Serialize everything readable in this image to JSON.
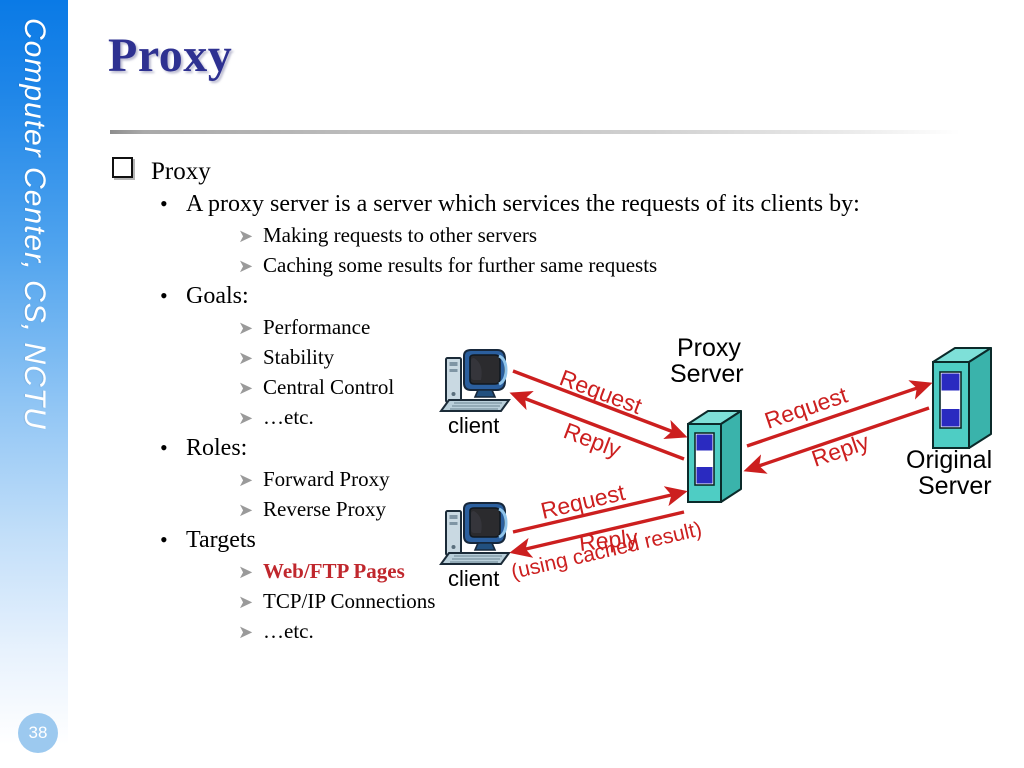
{
  "sidebar": {
    "label": "Computer Center, CS, NCTU",
    "page_number": "38",
    "gradient_top_color": "#0a7ae6",
    "badge_color": "#9cc9ef"
  },
  "slide": {
    "title": "Proxy",
    "title_color": "#2e3191",
    "rule_color": "#a9a9a9"
  },
  "outline": {
    "heading": "Proxy",
    "bullets": [
      {
        "level": 2,
        "text": "A proxy server is a server which services the requests of its clients by:",
        "marker": "bullet-dot"
      },
      {
        "level": 3,
        "text": "Making requests to other servers",
        "marker": "arrowhead"
      },
      {
        "level": 3,
        "text": "Caching some results for further same requests",
        "marker": "arrowhead"
      },
      {
        "level": 2,
        "text": "Goals:",
        "marker": "bullet-dot"
      },
      {
        "level": 3,
        "text": "Performance",
        "marker": "arrowhead"
      },
      {
        "level": 3,
        "text": "Stability",
        "marker": "arrowhead"
      },
      {
        "level": 3,
        "text": "Central Control",
        "marker": "arrowhead"
      },
      {
        "level": 3,
        "text": "…etc.",
        "marker": "arrowhead"
      },
      {
        "level": 2,
        "text": "Roles:",
        "marker": "bullet-dot"
      },
      {
        "level": 3,
        "text": "Forward Proxy",
        "marker": "arrowhead"
      },
      {
        "level": 3,
        "text": "Reverse Proxy",
        "marker": "arrowhead"
      },
      {
        "level": 2,
        "text": "Targets",
        "marker": "bullet-dot"
      },
      {
        "level": 3,
        "text": "Web/FTP Pages",
        "marker": "arrowhead",
        "highlight": true,
        "color": "#c0272d"
      },
      {
        "level": 3,
        "text": "TCP/IP Connections",
        "marker": "arrowhead"
      },
      {
        "level": 3,
        "text": "…etc.",
        "marker": "arrowhead"
      }
    ],
    "items": {
      "b0": "A proxy server is a server which services the requests of its clients by:",
      "b1": "Making requests to other servers",
      "b2": "Caching some results for further same requests",
      "b3": "Goals:",
      "b4": "Performance",
      "b5": "Stability",
      "b6": "Central Control",
      "b7": "…etc.",
      "b8": "Roles:",
      "b9": "Forward Proxy",
      "b10": "Reverse Proxy",
      "b11": "Targets",
      "b12": "Web/FTP Pages",
      "b13": "TCP/IP Connections",
      "b14": "…etc."
    }
  },
  "diagram": {
    "nodes": {
      "client_top": "client",
      "client_bottom": "client",
      "proxy_line1": "Proxy",
      "proxy_line2": "Server",
      "origin_line1": "Original",
      "origin_line2": "Server"
    },
    "edges": {
      "top_request": "Request",
      "top_reply": "Reply",
      "right_request": "Request",
      "right_reply": "Reply",
      "bottom_request": "Request",
      "bottom_reply": "Reply",
      "bottom_note": "(using cached result)"
    },
    "colors": {
      "arrow": "#cc1f1f",
      "server_face": "#4ecdc4",
      "server_side": "#3ab3ab",
      "server_top": "#7ee0d8",
      "panel_blue": "#2a2ac0",
      "panel_white": "#ffffff",
      "label_text": "#000000"
    }
  }
}
